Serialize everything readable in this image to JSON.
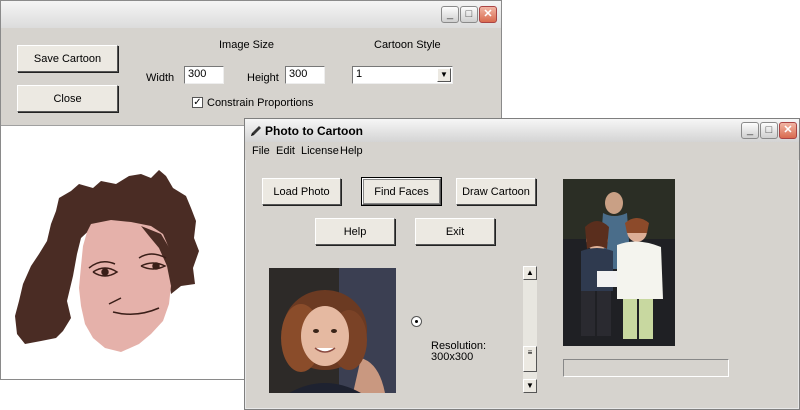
{
  "back_window": {
    "buttons": {
      "save": "Save Cartoon",
      "close": "Close"
    },
    "image_size": {
      "heading": "Image Size",
      "width_label": "Width",
      "width_value": "300",
      "height_label": "Height",
      "height_value": "300",
      "constrain_label": "Constrain Proportions",
      "constrain_checked": true
    },
    "cartoon_style": {
      "heading": "Cartoon Style",
      "selected": "1"
    },
    "window_controls": {
      "minimize": "_",
      "maximize": "□",
      "close": "✕"
    }
  },
  "front_window": {
    "title": "Photo to Cartoon",
    "menu": [
      "File",
      "Edit",
      "License",
      "Help"
    ],
    "buttons": {
      "load_photo": "Load Photo",
      "find_faces": "Find Faces",
      "draw_cartoon": "Draw Cartoon",
      "help": "Help",
      "exit": "Exit"
    },
    "resolution_label": "Resolution:",
    "resolution_value": "300x300",
    "progress": 0,
    "window_controls": {
      "minimize": "_",
      "maximize": "□",
      "close": "✕"
    }
  },
  "colors": {
    "hair": "#4a2c24",
    "skin": "#e5b1aa",
    "panel": "#d6d3ce"
  },
  "icons": [
    "pencil-icon",
    "checkmark-icon",
    "chevron-down-icon",
    "scroll-up-icon",
    "scroll-down-icon",
    "radio-icon"
  ]
}
